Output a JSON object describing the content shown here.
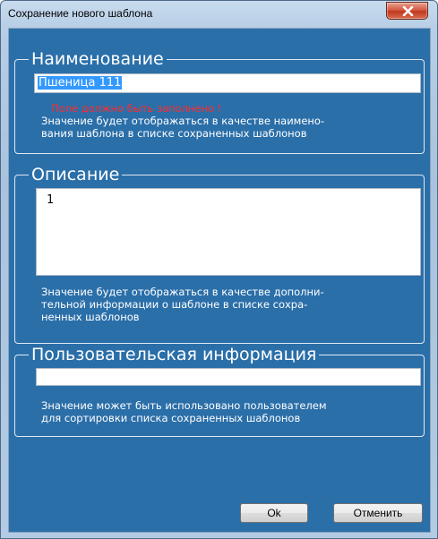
{
  "window": {
    "title": "Сохранение нового шаблона"
  },
  "name_group": {
    "legend": "Наименование",
    "value": "Пшеница 111",
    "error": "Поле должно быть заполнено !",
    "hint": "Значение будет отображаться в качестве наимено-\nвания шаблона в списке сохраненных шаблонов"
  },
  "description_group": {
    "legend": "Описание",
    "value": "1",
    "hint": "Значение будет отображаться в качестве дополни-\nтельной информации о шаблоне  в списке сохра-\nненных шаблонов"
  },
  "user_info_group": {
    "legend": "Пользовательская информация",
    "value": "",
    "hint": "Значение может быть использовано пользователем\nдля сортировки списка сохраненных шаблонов"
  },
  "buttons": {
    "ok_label": "Ok",
    "cancel_label": "Отменить"
  },
  "icons": {
    "close": "close-icon"
  },
  "colors": {
    "panel_background": "#2b6fa9",
    "error_text": "#ff2b2b",
    "selection": "#3399ff",
    "close_button": "#c8452c"
  }
}
